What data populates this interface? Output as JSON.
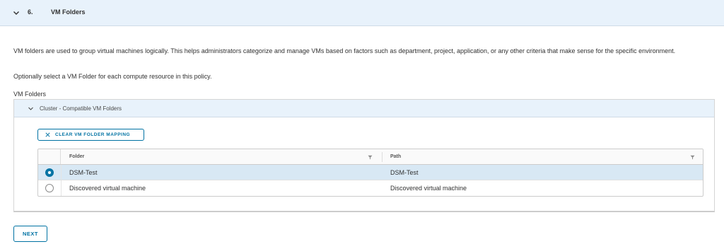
{
  "step": {
    "number": "6.",
    "title": "VM Folders",
    "chevron_icon": "chevron-down-icon"
  },
  "description": "VM folders are used to group virtual machines logically. This helps administrators categorize and manage VMs based on factors such as department, project, application, or any other criteria that make sense for the specific environment.",
  "hint": "Optionally select a VM Folder for each compute resource in this policy.",
  "vm_folders_label": "VM Folders",
  "panel": {
    "title": "Cluster - Compatible VM Folders",
    "chevron_icon": "chevron-down-icon",
    "clear_button_label": "CLEAR VM FOLDER MAPPING",
    "clear_icon": "close-icon"
  },
  "grid": {
    "columns": [
      "Folder",
      "Path"
    ],
    "filter_icon": "filter-icon",
    "rows": [
      {
        "folder": "DSM-Test",
        "path": "DSM-Test",
        "selected": true
      },
      {
        "folder": "Discovered virtual machine",
        "path": "Discovered virtual machine",
        "selected": false
      }
    ]
  },
  "next_button_label": "NEXT",
  "colors": {
    "accent": "#0072a3",
    "header_bg": "#e8f2fb",
    "selected_row_bg": "#d8e8f4"
  }
}
